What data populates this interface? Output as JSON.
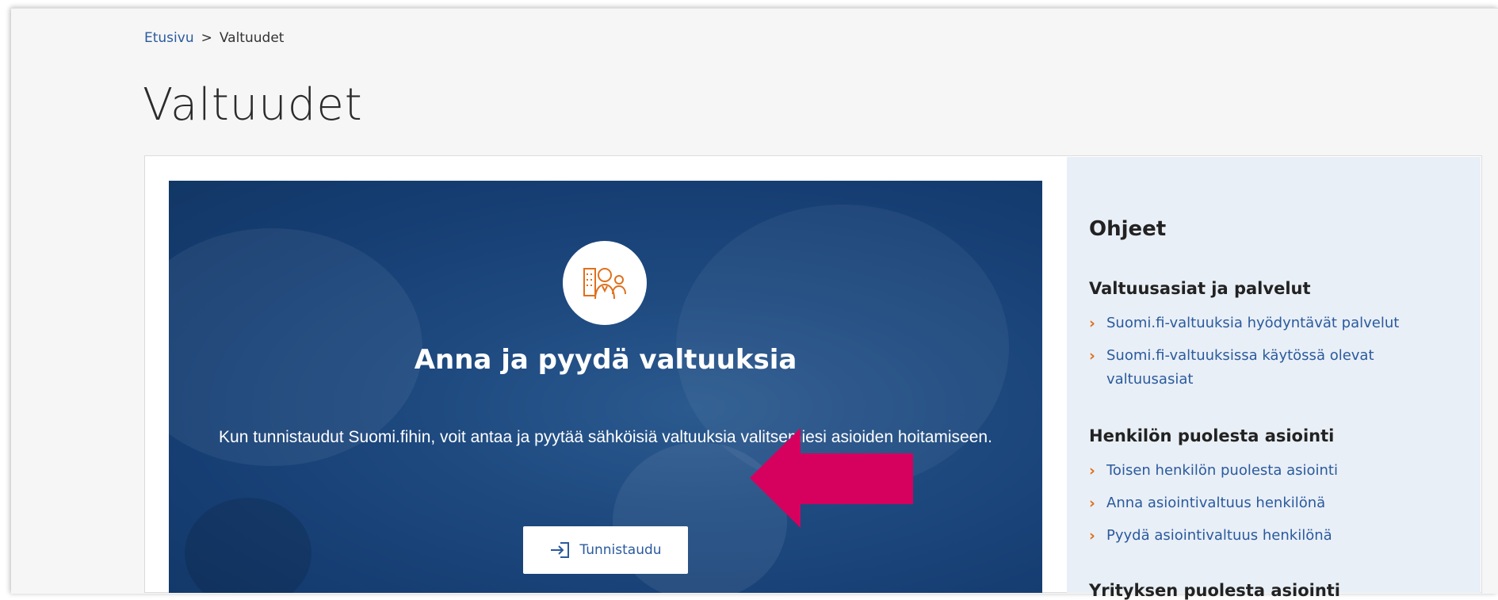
{
  "breadcrumb": {
    "home": "Etusivu",
    "separator": ">",
    "current": "Valtuudet"
  },
  "page": {
    "title": "Valtuudet"
  },
  "hero": {
    "title": "Anna ja pyydä valtuuksia",
    "text": "Kun tunnistaudut Suomi.fihin, voit antaa ja pyytää sähköisiä valtuuksia valitsemiesi asioiden hoitamiseen.",
    "button_label": "Tunnistaudu",
    "icon": "person-building-icon",
    "background_color": "#1e4a80"
  },
  "annotation": {
    "arrow_color": "#d6005f"
  },
  "sidebar": {
    "title": "Ohjeet",
    "sections": [
      {
        "heading": "Valtuusasiat ja palvelut",
        "links": [
          "Suomi.fi-valtuuksia hyödyntävät palvelut",
          "Suomi.fi-valtuuksissa käytössä olevat valtuusasiat"
        ]
      },
      {
        "heading": "Henkilön puolesta asiointi",
        "links": [
          "Toisen henkilön puolesta asiointi",
          "Anna asiointivaltuus henkilönä",
          "Pyydä asiointivaltuus henkilönä"
        ]
      },
      {
        "heading": "Yrityksen puolesta asiointi",
        "links": []
      }
    ],
    "link_chevron": "›",
    "accent_color": "#e0701b"
  }
}
